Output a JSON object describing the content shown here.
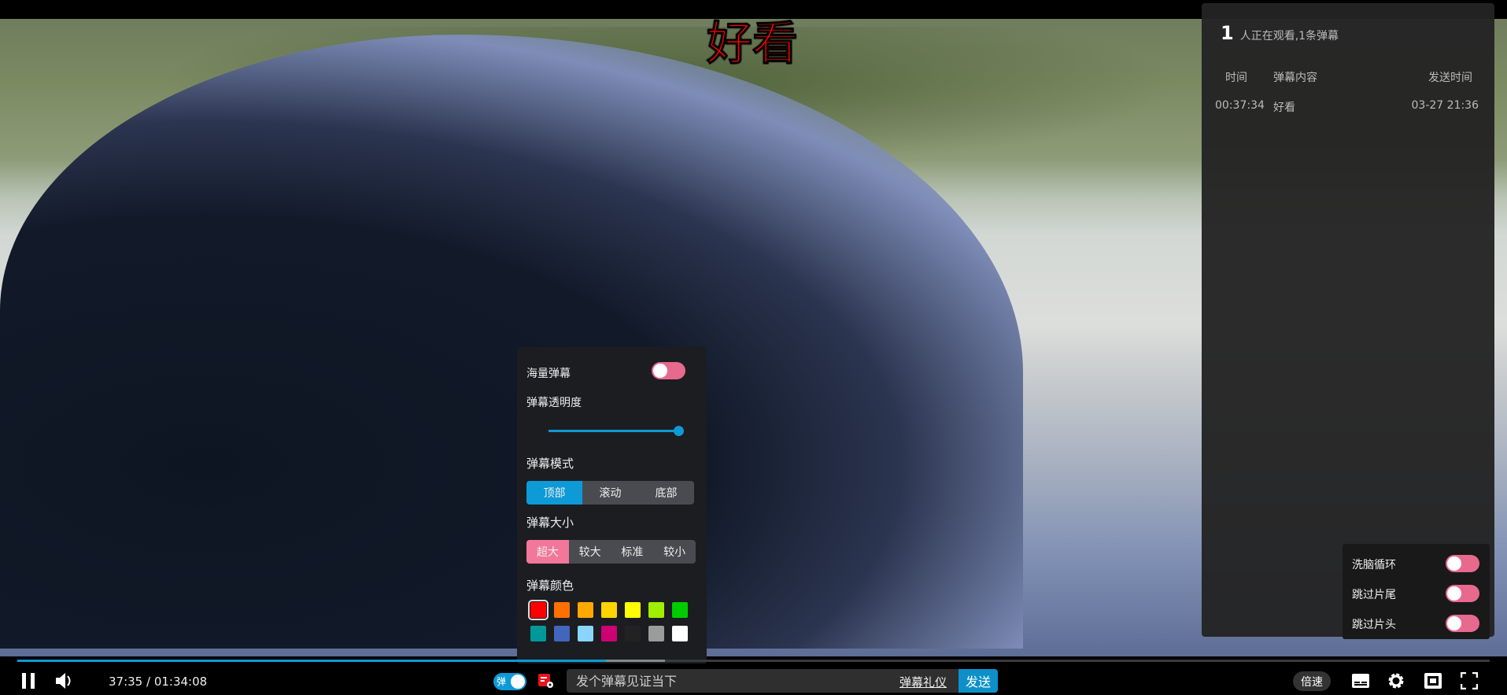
{
  "danmaku_overlay": "好看",
  "danmaku_list": {
    "viewer_count": "1",
    "summary": "人正在观看,1条弹幕",
    "columns": [
      "时间",
      "弹幕内容",
      "发送时间"
    ],
    "rows": [
      {
        "time": "00:37:34",
        "content": "好看",
        "sent": "03-27 21:36"
      }
    ]
  },
  "settings": {
    "massive_label": "海量弹幕",
    "massive_on": true,
    "opacity_label": "弹幕透明度",
    "opacity_value": 1.0,
    "mode_label": "弹幕模式",
    "modes": [
      "顶部",
      "滚动",
      "底部"
    ],
    "mode_selected": "顶部",
    "size_label": "弹幕大小",
    "sizes": [
      "超大",
      "较大",
      "标准",
      "较小"
    ],
    "size_selected": "超大",
    "color_label": "弹幕颜色",
    "colors": [
      "#ff0000",
      "#ff7000",
      "#ffa800",
      "#ffd400",
      "#ffff00",
      "#a0ee00",
      "#00cc00",
      "#009999",
      "#4266be",
      "#89d5ff",
      "#cc0273",
      "#222222",
      "#9b9b9b",
      "#ffffff"
    ],
    "color_selected": "#ff0000"
  },
  "loop_panel": {
    "items": [
      {
        "label": "洗脑循环",
        "on": true
      },
      {
        "label": "跳过片尾",
        "on": true
      },
      {
        "label": "跳过片头",
        "on": true
      }
    ]
  },
  "controls": {
    "current_time": "37:35",
    "duration": "01:34:08",
    "time_text": "37:35 / 01:34:08",
    "played": 0.4,
    "buffered": 0.44,
    "danmaku_toggle_label": "弹",
    "input_placeholder": "发个弹幕见证当下",
    "etiquette": "弹幕礼仪",
    "send": "发送",
    "speed": "倍速",
    "accent": "#0d9ad6",
    "pink": "#e8698e"
  }
}
